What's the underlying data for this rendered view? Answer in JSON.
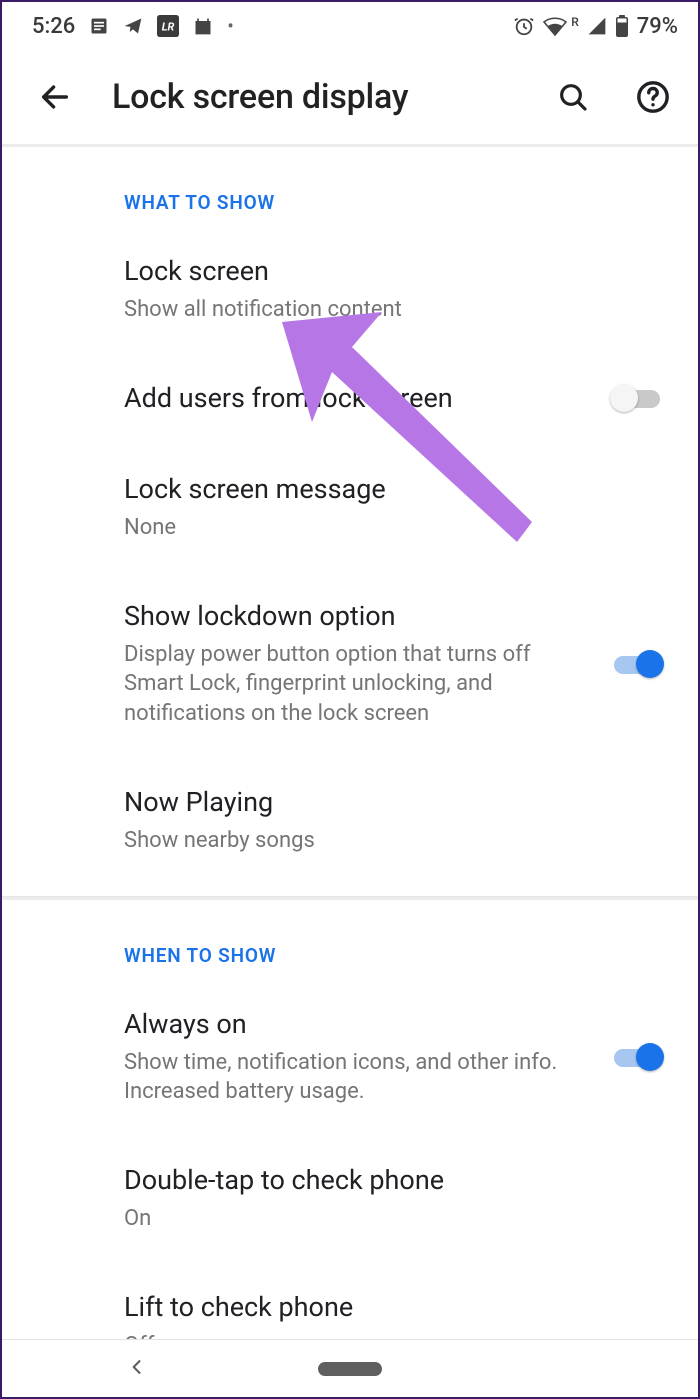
{
  "status": {
    "time": "5:26",
    "battery": "79%",
    "roaming": "R"
  },
  "header": {
    "title": "Lock screen display"
  },
  "sections": [
    {
      "title": "WHAT TO SHOW",
      "rows": [
        {
          "label": "Lock screen",
          "sub": "Show all notification content",
          "toggle": null
        },
        {
          "label": "Add users from lock screen",
          "sub": "",
          "toggle": false
        },
        {
          "label": "Lock screen message",
          "sub": "None",
          "toggle": null
        },
        {
          "label": "Show lockdown option",
          "sub": "Display power button option that turns off Smart Lock, fingerprint unlocking, and notifications on the lock screen",
          "toggle": true
        },
        {
          "label": "Now Playing",
          "sub": "Show nearby songs",
          "toggle": null
        }
      ]
    },
    {
      "title": "WHEN TO SHOW",
      "rows": [
        {
          "label": "Always on",
          "sub": "Show time, notification icons, and other info. Increased battery usage.",
          "toggle": true
        },
        {
          "label": "Double-tap to check phone",
          "sub": "On",
          "toggle": null
        },
        {
          "label": "Lift to check phone",
          "sub": "Off",
          "toggle": null
        }
      ]
    }
  ]
}
